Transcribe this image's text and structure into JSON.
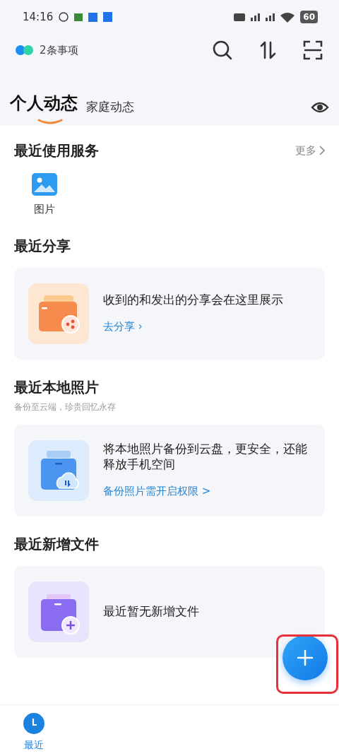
{
  "status_bar": {
    "time": "14:16",
    "battery": "60"
  },
  "header": {
    "reminder": "2条事项"
  },
  "tabs": [
    {
      "label": "个人动态",
      "selected": true
    },
    {
      "label": "家庭动态",
      "selected": false
    }
  ],
  "recent_services": {
    "title": "最近使用服务",
    "more": "更多",
    "items": [
      {
        "label": "图片"
      }
    ]
  },
  "sections": [
    {
      "kind": "share",
      "title": "最近分享",
      "message": "收到的和发出的分享会在这里展示",
      "action": "去分享 ›"
    },
    {
      "kind": "photos",
      "title": "最近本地照片",
      "subtitle": "备份至云端，珍贵回忆永存",
      "message": "将本地照片备份到云盘，更安全，还能释放手机空间",
      "action": "备份照片需开启权限 >"
    },
    {
      "kind": "files",
      "title": "最近新增文件",
      "message": "最近暂无新增文件"
    }
  ],
  "bottom_nav": [
    {
      "label": "最近",
      "selected": true
    }
  ]
}
